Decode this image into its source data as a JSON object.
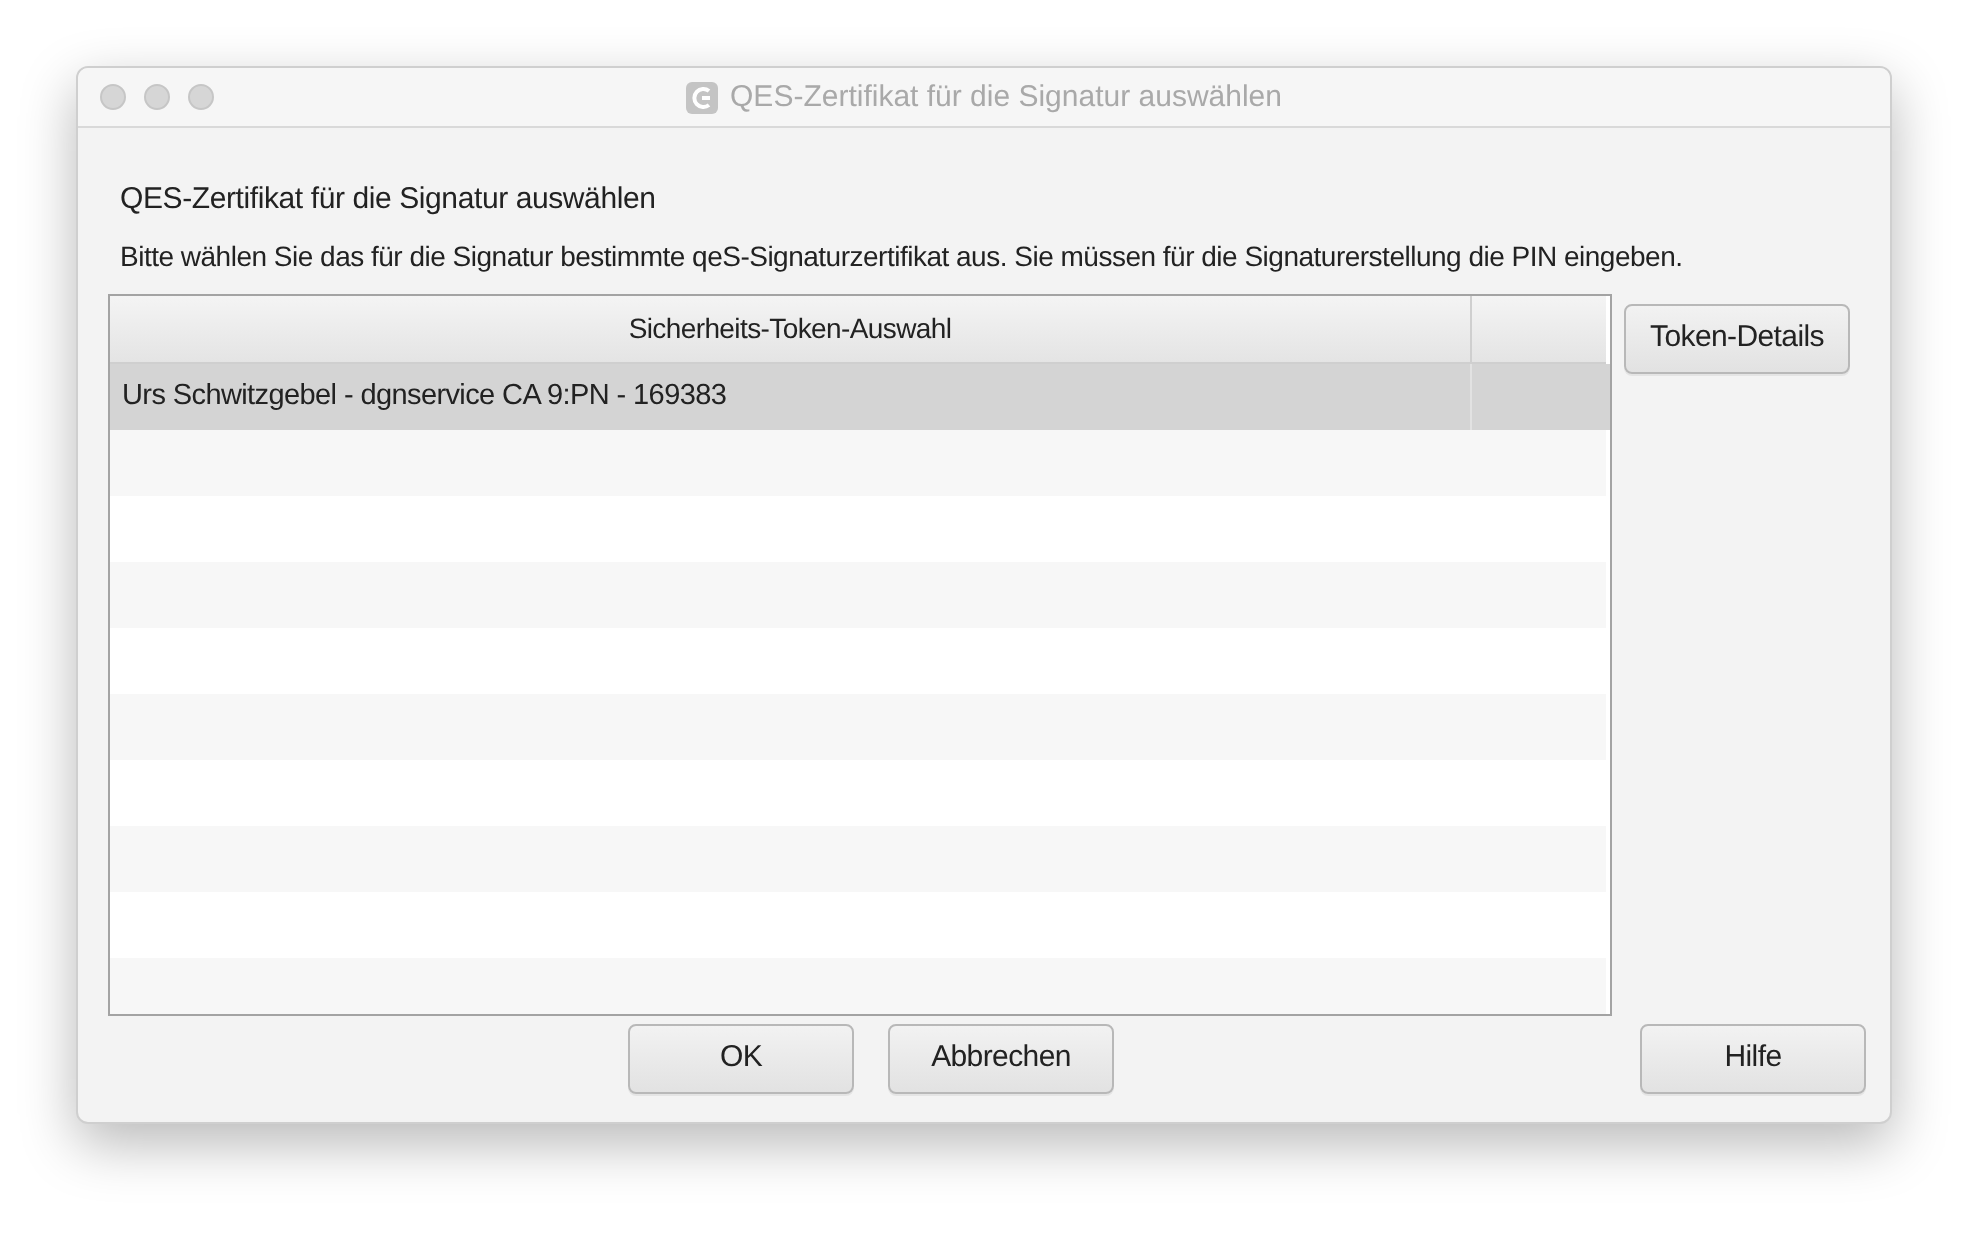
{
  "window": {
    "title": "QES-Zertifikat für die Signatur auswählen"
  },
  "heading": "QES-Zertifikat für die Signatur auswählen",
  "description": "Bitte wählen Sie das für die Signatur bestimmte qeS-Signaturzertifikat aus. Sie müssen für die Signaturerstellung die PIN eingeben.",
  "table": {
    "columns": [
      "Sicherheits-Token-Auswahl"
    ],
    "rows": [
      {
        "cells": [
          "Urs Schwitzgebel - dgnservice CA 9:PN - 169383"
        ],
        "selected": true
      }
    ]
  },
  "side_buttons": [
    "Token-Details"
  ],
  "buttons": [
    "OK",
    "Abbrechen"
  ],
  "help_button": "Hilfe"
}
